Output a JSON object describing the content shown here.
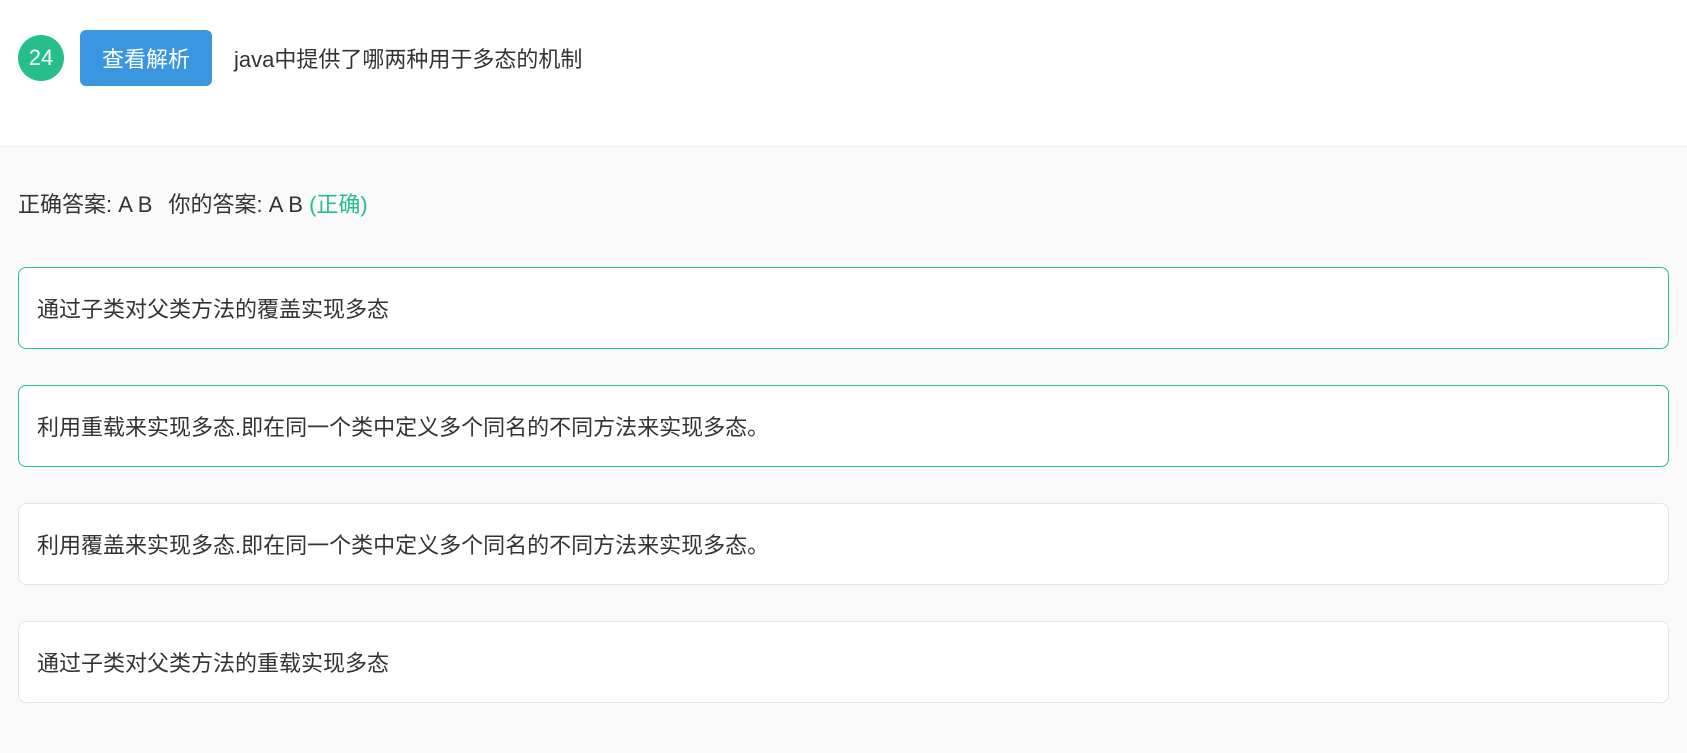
{
  "question": {
    "number": "24",
    "view_analysis_label": "查看解析",
    "text": "java中提供了哪两种用于多态的机制"
  },
  "answer": {
    "correct_prefix": "正确答案: ",
    "correct_value": "A B",
    "your_prefix": "你的答案: ",
    "your_value": "A B",
    "status_label": "(正确)"
  },
  "options": [
    {
      "text": "通过子类对父类方法的覆盖实现多态",
      "correct": true
    },
    {
      "text": "利用重载来实现多态.即在同一个类中定义多个同名的不同方法来实现多态。",
      "correct": true
    },
    {
      "text": "利用覆盖来实现多态.即在同一个类中定义多个同名的不同方法来实现多态。",
      "correct": false
    },
    {
      "text": "通过子类对父类方法的重载实现多态",
      "correct": false
    }
  ]
}
